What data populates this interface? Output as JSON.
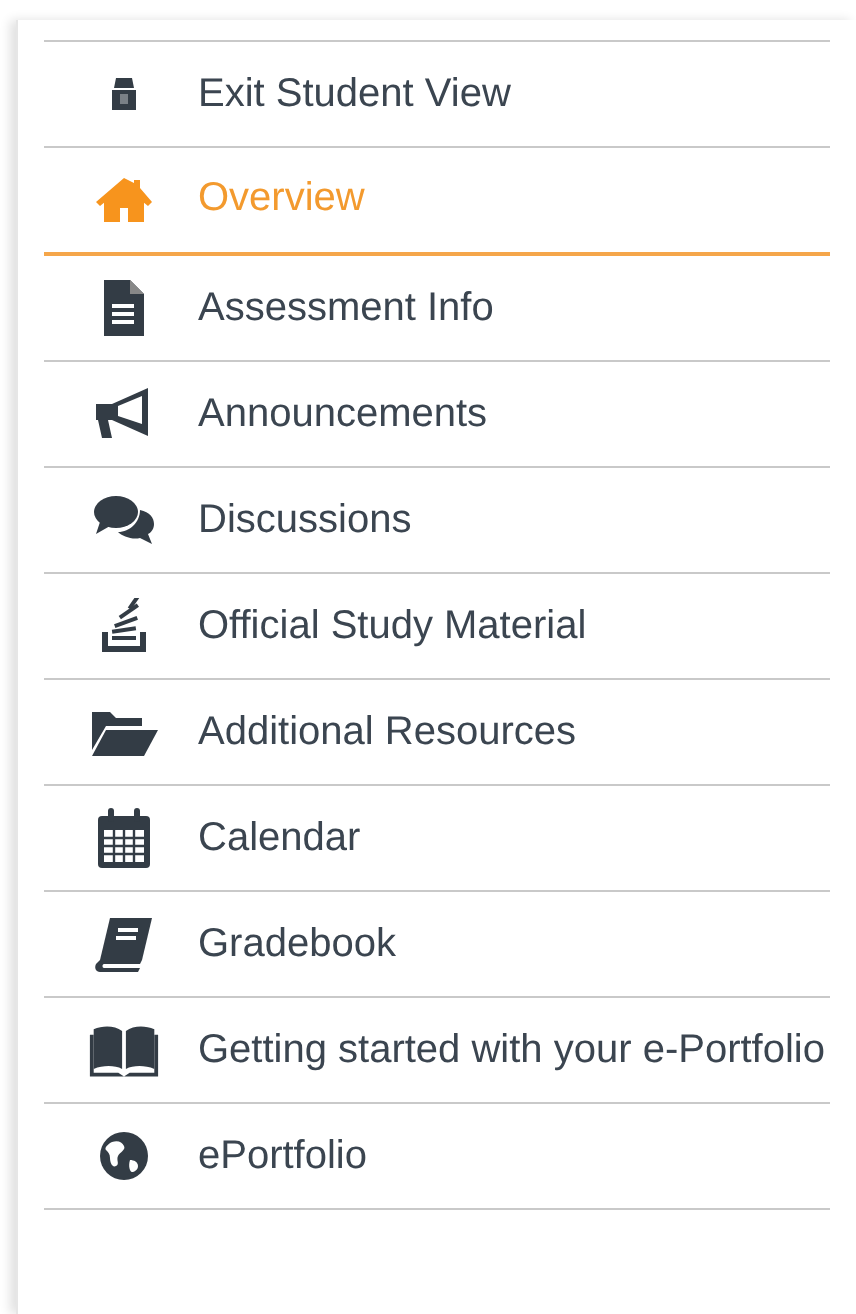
{
  "menu": {
    "items": [
      {
        "label": "Exit Student View",
        "selected": false
      },
      {
        "label": "Overview",
        "selected": true
      },
      {
        "label": "Assessment Info",
        "selected": false
      },
      {
        "label": "Announcements",
        "selected": false
      },
      {
        "label": "Discussions",
        "selected": false
      },
      {
        "label": "Official Study Material",
        "selected": false
      },
      {
        "label": "Additional Resources",
        "selected": false
      },
      {
        "label": "Calendar",
        "selected": false
      },
      {
        "label": "Gradebook",
        "selected": false
      },
      {
        "label": "Getting started with your e-Portfolio",
        "selected": false
      },
      {
        "label": "ePortfolio",
        "selected": false
      }
    ]
  }
}
